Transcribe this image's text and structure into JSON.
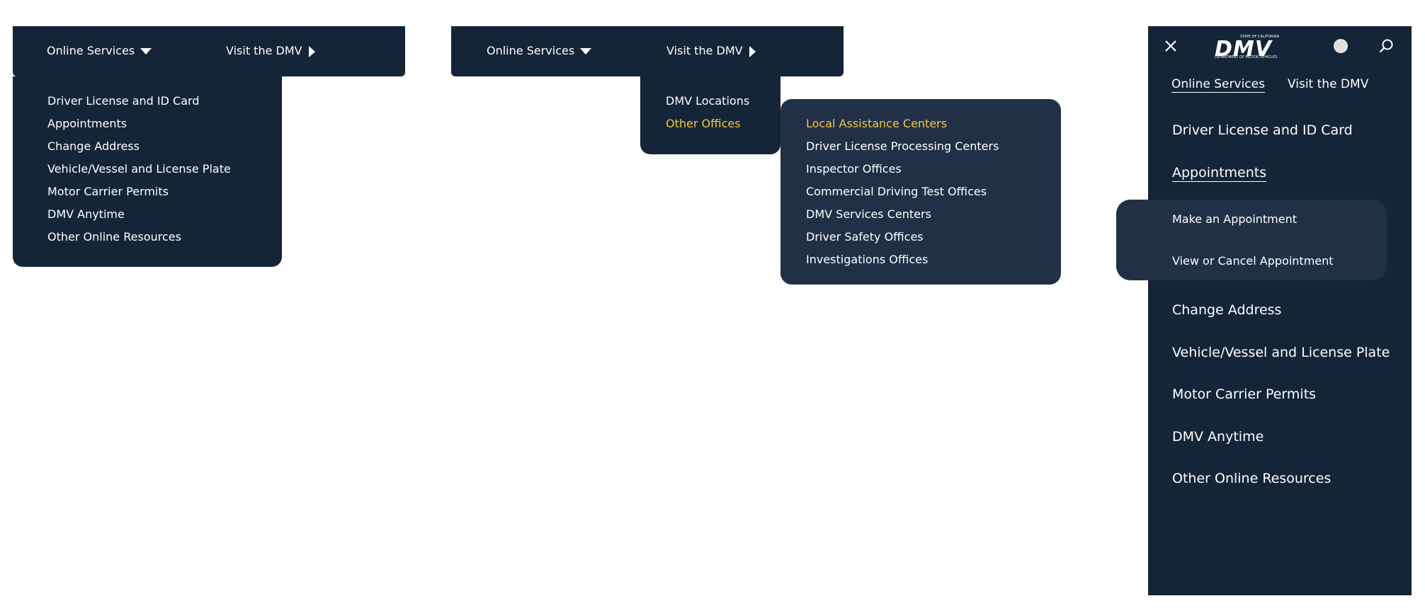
{
  "panel1": {
    "nav": {
      "online_services": "Online Services",
      "visit_dmv": "Visit the DMV"
    },
    "dropdown": [
      "Driver License and ID Card",
      "Appointments",
      "Change Address",
      "Vehicle/Vessel and License Plate",
      "Motor Carrier Permits",
      "DMV Anytime",
      "Other Online Resources"
    ]
  },
  "panel2": {
    "nav": {
      "online_services": "Online Services",
      "visit_dmv": "Visit the DMV"
    },
    "dropdown": [
      "DMV Locations",
      "Other Offices"
    ],
    "active_item": "Other Offices",
    "submenu": [
      "Local Assistance Centers",
      "Driver License Processing Centers",
      "Inspector Offices",
      "Commercial Driving Test Offices",
      "DMV Services Centers",
      "Driver Safety Offices",
      "Investigations Offices"
    ],
    "highlight_color": "#f2c744"
  },
  "panel3": {
    "logo": {
      "text": "DMV",
      "top_line": "STATE OF CALIFORNIA",
      "bottom_line": "DEPARTMENT OF MOTOR VEHICLES"
    },
    "tabs": {
      "online_services": "Online Services",
      "visit_dmv": "Visit the DMV"
    },
    "items": [
      "Driver License and ID Card",
      "Appointments",
      "Change Address",
      "Vehicle/Vessel and License Plate",
      "Motor Carrier Permits",
      "DMV Anytime",
      "Other Online Resources"
    ],
    "appointments_sub": [
      "Make an Appointment",
      "View or Cancel Appointment"
    ]
  },
  "colors": {
    "navy": "#142537",
    "submenu_navy": "#213047",
    "gold": "#f2c744"
  }
}
